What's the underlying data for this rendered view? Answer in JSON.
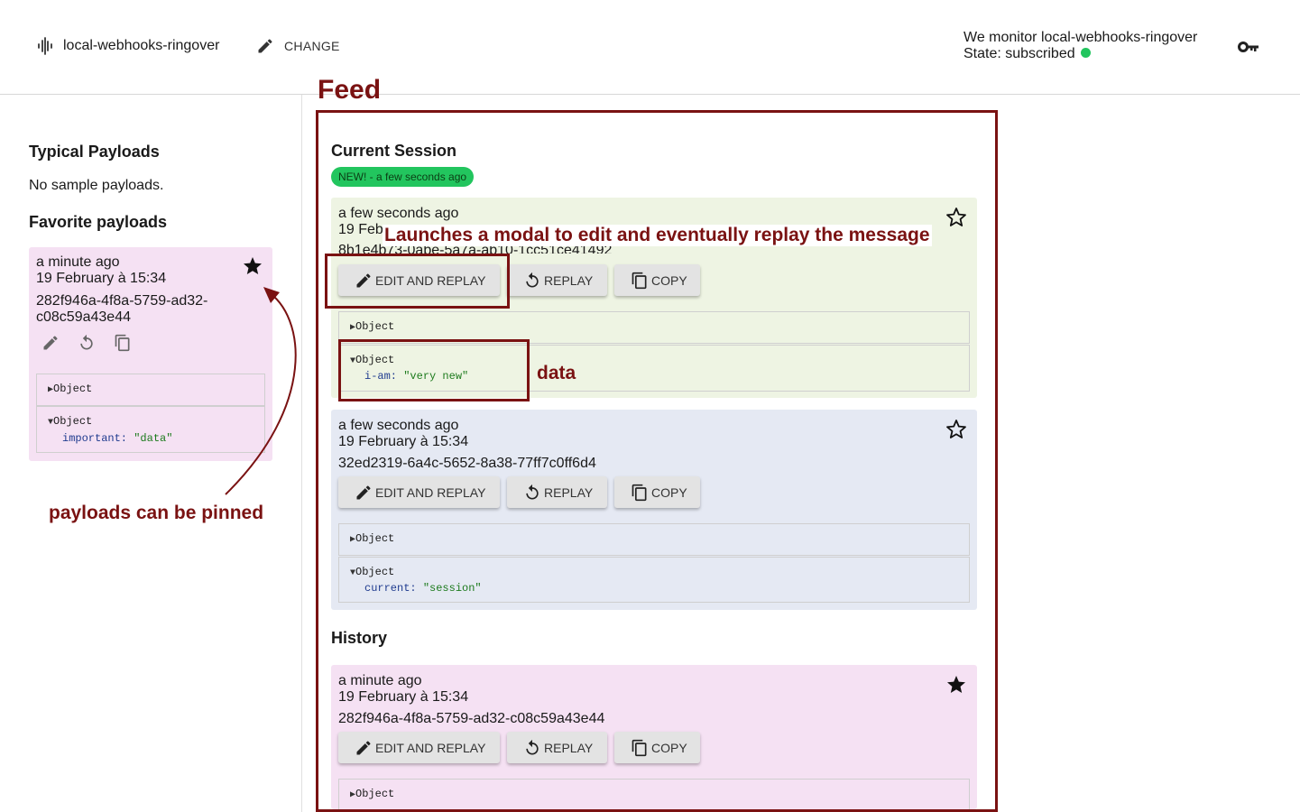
{
  "header": {
    "app_name": "local-webhooks-ringover",
    "change_label": "CHANGE",
    "monitor_text": "We monitor local-webhooks-ringover",
    "state_text": "State: subscribed",
    "status_color": "#22c55e",
    "icons": {
      "brand": "waveform-icon",
      "change": "pencil-icon",
      "auth": "key-icon"
    }
  },
  "sidebar": {
    "typical_title": "Typical Payloads",
    "typical_empty": "No sample payloads.",
    "favorites_title": "Favorite payloads",
    "favorite": {
      "time_ago": "a minute ago",
      "date": "19 February à 15:34",
      "id_line1": "282f946a-4f8a-5759-ad32-",
      "id_line2": "c08c59a43e44",
      "headers_label": "Object",
      "body_label": "Object",
      "body_key": "important:",
      "body_value": "\"data\""
    }
  },
  "annotations": {
    "feed": "Feed",
    "modal": "Launches a modal to edit and eventually replay the message",
    "data": "data",
    "pinned": "payloads can be pinned",
    "color": "#7a1212"
  },
  "feed": {
    "current_title": "Current Session",
    "new_badge": "NEW! - a few seconds ago",
    "history_title": "History",
    "buttons": {
      "edit": "EDIT AND REPLAY",
      "replay": "REPLAY",
      "copy": "COPY"
    },
    "cards": [
      {
        "time_ago": "a few seconds ago",
        "date_partial": "19 Feb",
        "id_partial": "8b1e4b73-0abe-5a7a-ab10-1cc51ce41492",
        "headers_label": "Object",
        "body_label": "Object",
        "body_key": "i-am:",
        "body_value": "\"very new\"",
        "bg": "#eef4e3"
      },
      {
        "time_ago": "a few seconds ago",
        "date": "19 February à 15:34",
        "id": "32ed2319-6a4c-5652-8a38-77ff7c0ff6d4",
        "headers_label": "Object",
        "body_label": "Object",
        "body_key": "current:",
        "body_value": "\"session\"",
        "bg": "#e5e9f3"
      },
      {
        "time_ago": "a minute ago",
        "date": "19 February à 15:34",
        "id": "282f946a-4f8a-5759-ad32-c08c59a43e44",
        "headers_label": "Object",
        "bg": "#f5e1f3"
      }
    ]
  }
}
